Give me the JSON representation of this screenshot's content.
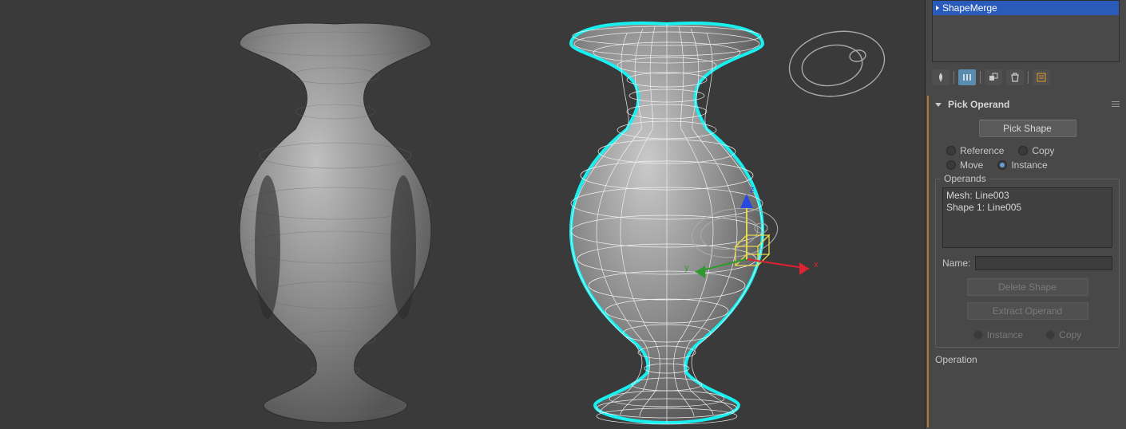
{
  "modifiers": {
    "items": [
      "ShapeMerge"
    ]
  },
  "pick_operand": {
    "title": "Pick Operand",
    "pick_button": "Pick Shape",
    "radios_top": {
      "reference": "Reference",
      "copy": "Copy",
      "move": "Move",
      "instance": "Instance"
    },
    "selected_top": "instance"
  },
  "operands_group": {
    "title": "Operands",
    "items": [
      "Mesh: Line003",
      "Shape 1: Line005"
    ],
    "name_label": "Name:",
    "name_value": "",
    "delete_button": "Delete Shape",
    "extract_button": "Extract Operand",
    "radios_bottom": {
      "instance": "Instance",
      "copy": "Copy"
    }
  },
  "operation_title": "Operation",
  "toolbar_icons": [
    "pin",
    "bars-active",
    "layers",
    "trash",
    "settings"
  ],
  "gizmo_axes": {
    "x": "x",
    "y": "y",
    "z": "z"
  }
}
